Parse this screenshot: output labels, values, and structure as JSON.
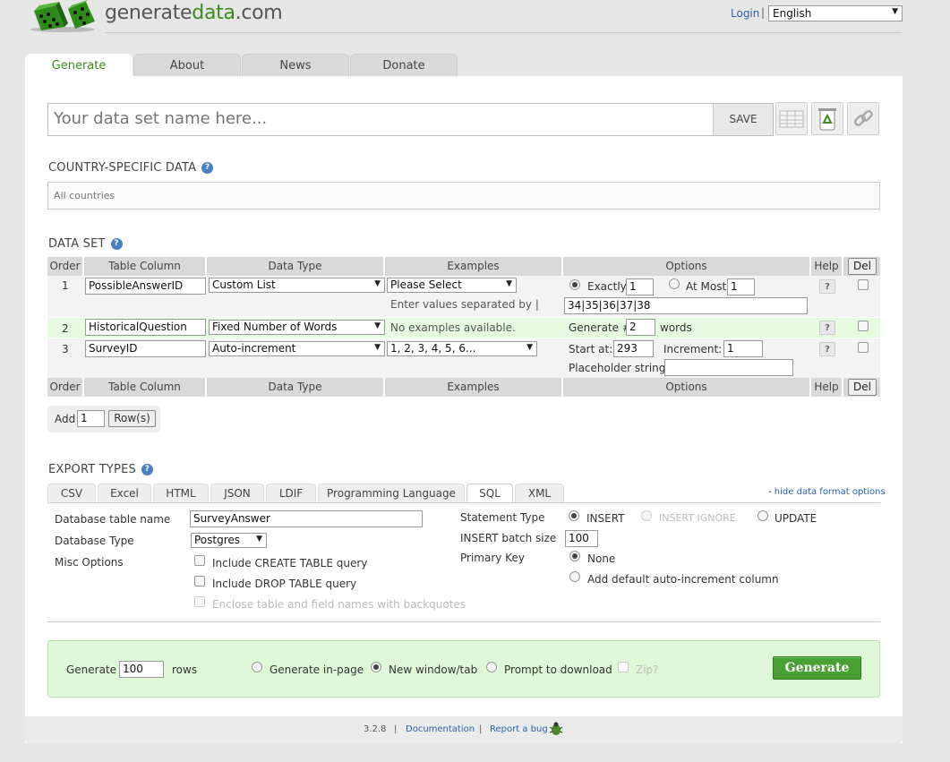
{
  "header": {
    "logo_prefix": "generate",
    "logo_accent": "data",
    "logo_suffix": ".com",
    "login": "Login",
    "separator": "|",
    "language": "English"
  },
  "tabs": [
    {
      "label": "Generate",
      "active": true
    },
    {
      "label": "About"
    },
    {
      "label": "News"
    },
    {
      "label": "Donate"
    }
  ],
  "dataset_name": {
    "placeholder": "Your data set name here...",
    "save_label": "SAVE"
  },
  "country": {
    "title": "COUNTRY-SPECIFIC DATA",
    "value": "All countries"
  },
  "dataset": {
    "title": "DATA SET",
    "headers": [
      "Order",
      "Table Column",
      "Data Type",
      "Examples",
      "Options",
      "Help",
      "Del"
    ],
    "rows": [
      {
        "order": "1",
        "column": "PossibleAnswerID",
        "type": "Custom List",
        "example": "Please Select",
        "note": "Enter values separated by |",
        "opt_exactly_label": "Exactly",
        "opt_exactly_value": "1",
        "opt_atmost_label": "At Most",
        "opt_atmost_value": "1",
        "values": "34|35|36|37|38"
      },
      {
        "order": "2",
        "column": "HistoricalQuestion",
        "type": "Fixed Number of Words",
        "example": "No examples available.",
        "generate_label": "Generate #",
        "generate_value": "2",
        "unit": "words"
      },
      {
        "order": "3",
        "column": "SurveyID",
        "type": "Auto-increment",
        "example": "1, 2, 3, 4, 5, 6...",
        "start_label": "Start at:",
        "start_value": "293",
        "increment_label": "Increment:",
        "increment_value": "1",
        "placeholder_label": "Placeholder string:"
      }
    ],
    "help_mark": "?",
    "add_label": "Add",
    "add_value": "1",
    "rows_button": "Row(s)"
  },
  "export": {
    "title": "EXPORT TYPES",
    "tabs": [
      "CSV",
      "Excel",
      "HTML",
      "JSON",
      "LDIF",
      "Programming Language",
      "SQL",
      "XML"
    ],
    "active_tab": "SQL",
    "hide_link": "hide data format options",
    "hide_dash": "-",
    "db_table_label": "Database table name",
    "db_table_value": "SurveyAnswer",
    "db_type_label": "Database Type",
    "db_type_value": "Postgres",
    "misc_label": "Misc Options",
    "misc_options": [
      "Include CREATE TABLE query",
      "Include DROP TABLE query",
      "Enclose table and field names with backquotes"
    ],
    "statement_label": "Statement Type",
    "statement_options": [
      "INSERT",
      "INSERT IGNORE",
      "UPDATE"
    ],
    "batch_label": "INSERT batch size",
    "batch_value": "100",
    "pk_label": "Primary Key",
    "pk_options": [
      "None",
      "Add default auto-increment column"
    ]
  },
  "generate": {
    "label": "Generate",
    "rows_value": "100",
    "rows_label": "rows",
    "options": [
      "Generate in-page",
      "New window/tab",
      "Prompt to download"
    ],
    "zip_label": "Zip?",
    "button": "Generate"
  },
  "footer": {
    "version": "3.2.8",
    "sep": "|",
    "docs": "Documentation",
    "bug": "Report a bug"
  },
  "colors": {
    "accent": "#3a8b1e",
    "link": "#2a61b0",
    "generate_bg": "#dff8d8",
    "row_highlight": "#e6fbe0"
  }
}
